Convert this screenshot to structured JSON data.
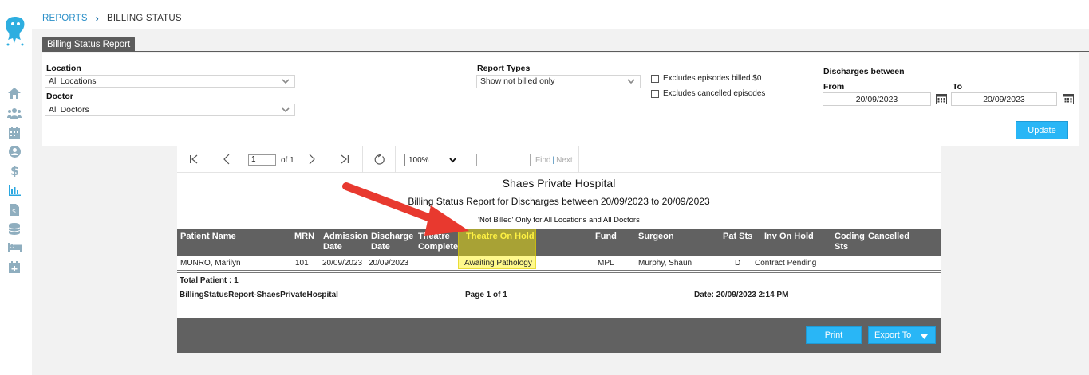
{
  "breadcrumb": {
    "reports": "REPORTS",
    "current": "BILLING STATUS"
  },
  "tab": {
    "label": "Billing Status Report"
  },
  "filters": {
    "location_label": "Location",
    "location_value": "All Locations",
    "doctor_label": "Doctor",
    "doctor_value": "All Doctors",
    "report_types_label": "Report Types",
    "report_types_value": "Show not billed only",
    "exclude_billed_zero": "Excludes episodes billed $0",
    "exclude_cancelled": "Excludes cancelled episodes",
    "discharges_label": "Discharges between",
    "from_label": "From",
    "from_value": "20/09/2023",
    "to_label": "To",
    "to_value": "20/09/2023",
    "update_label": "Update"
  },
  "toolbar": {
    "page_value": "1",
    "of_pages": "of 1",
    "zoom_value": "100%",
    "find_label": "Find",
    "find_sep": "|",
    "next_label": "Next"
  },
  "report": {
    "hospital": "Shaes Private Hospital",
    "subtitle": "Billing Status Report for Discharges between 20/09/2023 to 20/09/2023",
    "filter_text": "'Not Billed' Only for All Locations and All Doctors",
    "columns": {
      "patient_name": "Patient Name",
      "mrn": "MRN",
      "admission_1": "Admission",
      "admission_2": "Date",
      "discharge_1": "Discharge",
      "discharge_2": "Date",
      "theatre_1": "Theatre",
      "theatre_2": "Complete",
      "theatre_on_hold": "Theatre On Hold",
      "fund": "Fund",
      "surgeon": "Surgeon",
      "pat_sts": "Pat Sts",
      "inv_on_hold": "Inv On Hold",
      "coding_1": "Coding",
      "coding_2": "Sts",
      "cancelled": "Cancelled"
    },
    "row": {
      "patient_name": "MUNRO, Marilyn",
      "mrn": "101",
      "admission_date": "20/09/2023",
      "discharge_date": "20/09/2023",
      "theatre_on_hold": "Awaiting Pathology",
      "fund": "MPL",
      "surgeon": "Murphy, Shaun",
      "pat_sts": "D",
      "inv_on_hold": "Contract Pending"
    },
    "total": "Total Patient : 1",
    "footer_name": "BillingStatusReport-ShaesPrivateHospital",
    "footer_page": "Page 1 of 1",
    "footer_date": "Date: 20/09/2023 2:14 PM"
  },
  "actions": {
    "print_label": "Print",
    "export_label": "Export To"
  },
  "colors": {
    "accent_blue": "#29b6f6",
    "header_grey": "#616161",
    "highlight_yellow": "#fff200",
    "annotation_red": "#e8392f",
    "nav_icon": "#8faebf"
  }
}
